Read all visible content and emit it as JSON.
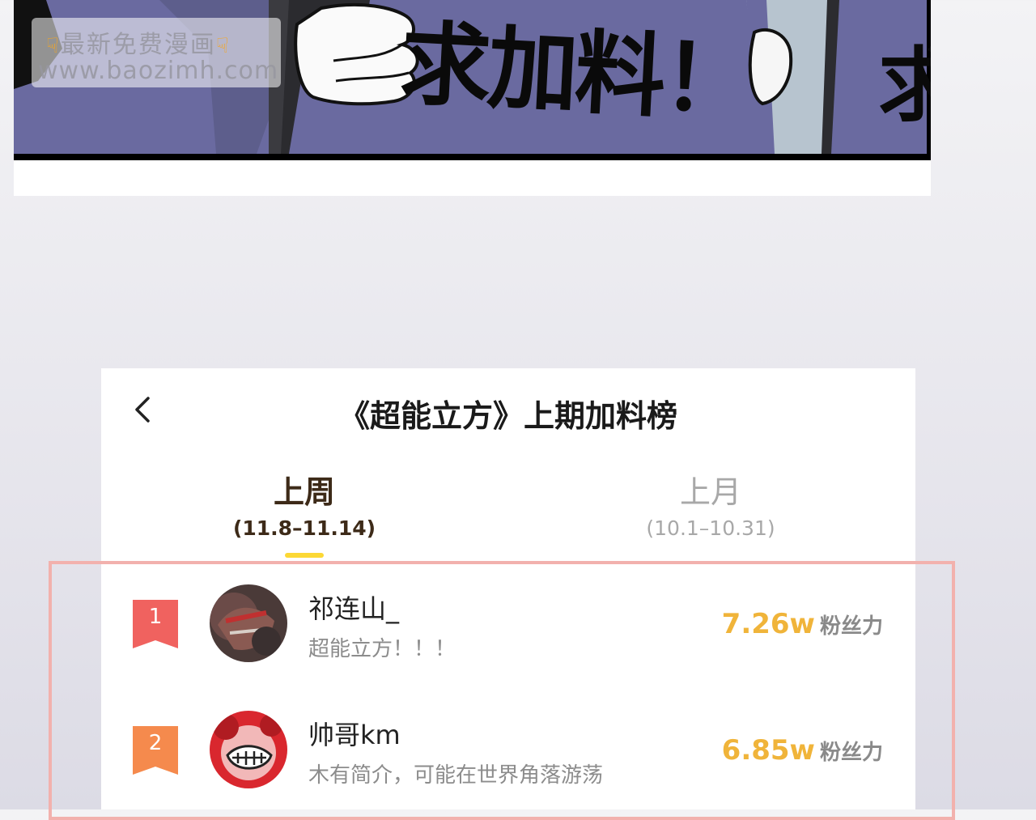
{
  "comic": {
    "speech_text": "求加料！",
    "speech_text_cut": "求",
    "watermark": {
      "line1": "最新免费漫画",
      "line2": "www.baozimh.com",
      "hand_icon": "point-down-hand-icon"
    }
  },
  "card": {
    "back_icon": "chevron-left-icon",
    "title": "《超能立方》上期加料榜",
    "tabs": [
      {
        "label": "上周",
        "range": "(11.8–11.14)",
        "active": true
      },
      {
        "label": "上月",
        "range": "(10.1–10.31)",
        "active": false
      }
    ],
    "ranking": [
      {
        "rank": "1",
        "name": "祁连山_",
        "bio": "超能立方！！！",
        "score": "7.26w",
        "unit": "粉丝力",
        "badge_color": "#f0625f"
      },
      {
        "rank": "2",
        "name": "帅哥km",
        "bio": "木有简介，可能在世界角落游荡",
        "score": "6.85w",
        "unit": "粉丝力",
        "badge_color": "#f58a4d"
      }
    ]
  },
  "colors": {
    "accent_yellow": "#fcd835",
    "score_gold": "#f0b43a",
    "active_tab_brown": "#3d2a18",
    "inactive_tab_gray": "#a8a8a8",
    "highlight_border": "#f2b1ad"
  }
}
